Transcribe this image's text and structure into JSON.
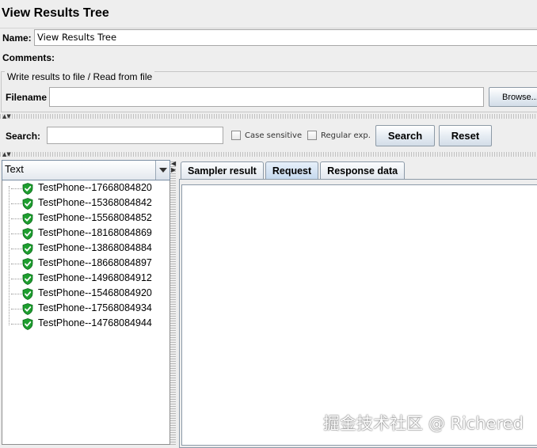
{
  "title": "View Results Tree",
  "name_field": {
    "label": "Name:",
    "value": "View Results Tree"
  },
  "comments_field": {
    "label": "Comments:"
  },
  "file_section": {
    "legend": "Write results to file / Read from file",
    "filename_label": "Filename",
    "filename_value": "",
    "browse_label": "Browse..."
  },
  "search_bar": {
    "label": "Search:",
    "value": "",
    "case_sensitive_label": "Case sensitive",
    "regular_exp_label": "Regular exp.",
    "search_button": "Search",
    "reset_button": "Reset"
  },
  "renderer": {
    "selected": "Text"
  },
  "tree": {
    "items": [
      {
        "label": "TestPhone--17668084820",
        "status": "success"
      },
      {
        "label": "TestPhone--15368084842",
        "status": "success"
      },
      {
        "label": "TestPhone--15568084852",
        "status": "success"
      },
      {
        "label": "TestPhone--18168084869",
        "status": "success"
      },
      {
        "label": "TestPhone--13868084884",
        "status": "success"
      },
      {
        "label": "TestPhone--18668084897",
        "status": "success"
      },
      {
        "label": "TestPhone--14968084912",
        "status": "success"
      },
      {
        "label": "TestPhone--15468084920",
        "status": "success"
      },
      {
        "label": "TestPhone--17568084934",
        "status": "success"
      },
      {
        "label": "TestPhone--14768084944",
        "status": "success"
      }
    ]
  },
  "tabs": [
    {
      "label": "Sampler result",
      "active": false
    },
    {
      "label": "Request",
      "active": true
    },
    {
      "label": "Response data",
      "active": false
    }
  ],
  "watermark": "掘金技术社区 @ Richered",
  "colors": {
    "success_icon": "#1e9e2f",
    "active_tab": "#c6d9ee"
  }
}
